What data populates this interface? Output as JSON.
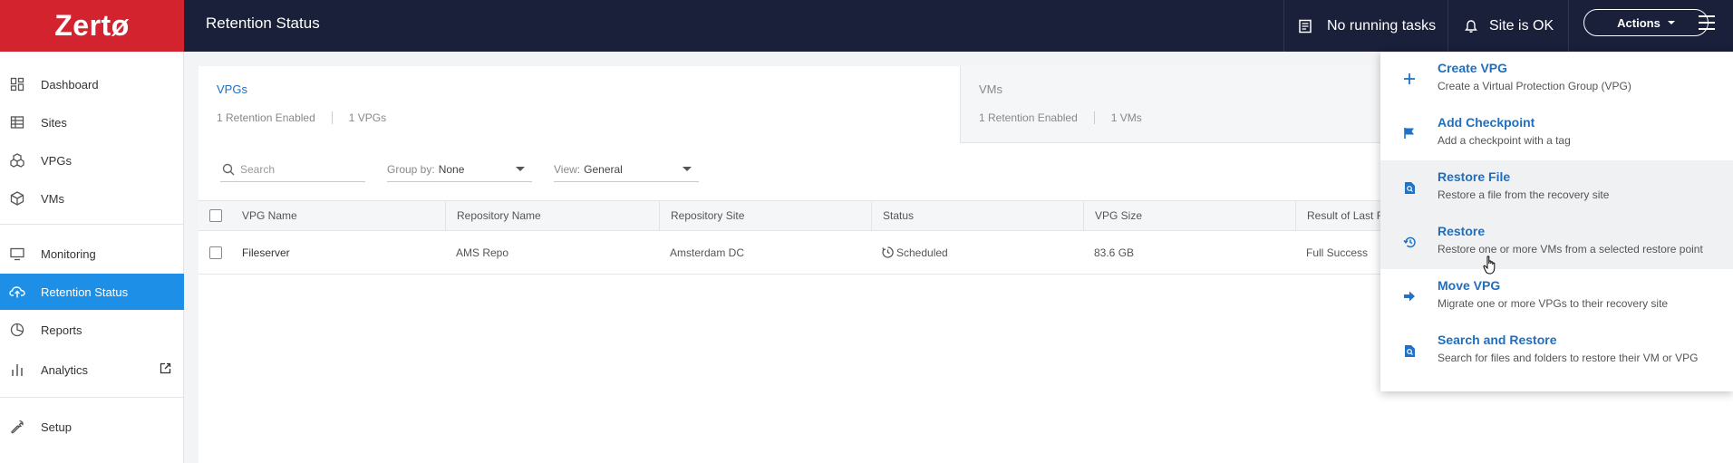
{
  "topbar": {
    "logo": "Zertø",
    "page_title": "Retention Status",
    "tasks": "No running tasks",
    "site_status": "Site is OK",
    "actions_label": "Actions"
  },
  "sidebar": {
    "items": [
      {
        "label": "Dashboard",
        "icon": "dashboard-icon"
      },
      {
        "label": "Sites",
        "icon": "sites-icon"
      },
      {
        "label": "VPGs",
        "icon": "vpgs-icon"
      },
      {
        "label": "VMs",
        "icon": "vms-icon"
      },
      {
        "label": "Monitoring",
        "icon": "monitor-icon"
      },
      {
        "label": "Retention Status",
        "icon": "cloud-upload-icon"
      },
      {
        "label": "Reports",
        "icon": "pie-chart-icon"
      },
      {
        "label": "Analytics",
        "icon": "bar-chart-icon"
      },
      {
        "label": "Setup",
        "icon": "wrench-icon"
      }
    ]
  },
  "summary": {
    "vpgs": {
      "title": "VPGs",
      "retention": "1 Retention Enabled",
      "count": "1 VPGs"
    },
    "vms": {
      "title": "VMs",
      "retention": "1 Retention Enabled",
      "count": "1 VMs"
    }
  },
  "filters": {
    "search_placeholder": "Search",
    "group_by_label": "Group by:",
    "group_by_value": "None",
    "view_label": "View:",
    "view_value": "General"
  },
  "table": {
    "headers": [
      "VPG Name",
      "Repository Name",
      "Repository Site",
      "Status",
      "VPG Size",
      "Result of Last R"
    ],
    "rows": [
      {
        "vpg_name": "Fileserver",
        "repository_name": "AMS Repo",
        "repository_site": "Amsterdam DC",
        "status": "Scheduled",
        "vpg_size": "83.6 GB",
        "result": "Full Success"
      }
    ]
  },
  "actions_menu": [
    {
      "title": "Create VPG",
      "desc": "Create a Virtual Protection Group (VPG)",
      "icon": "plus-icon"
    },
    {
      "title": "Add Checkpoint",
      "desc": "Add a checkpoint with a tag",
      "icon": "flag-icon"
    },
    {
      "title": "Restore File",
      "desc": "Restore a file from the recovery site",
      "icon": "file-search-icon"
    },
    {
      "title": "Restore",
      "desc": "Restore one or more VMs from a selected restore point",
      "icon": "history-icon"
    },
    {
      "title": "Move VPG",
      "desc": "Migrate one or more VPGs to their recovery site",
      "icon": "arrow-right-icon"
    },
    {
      "title": "Search and Restore",
      "desc": "Search for files and folders to restore their VM or VPG",
      "icon": "file-search-icon"
    }
  ],
  "colors": {
    "accent": "#1e8fe6",
    "brand": "#d3232f",
    "topbar": "#1a1f3a"
  }
}
